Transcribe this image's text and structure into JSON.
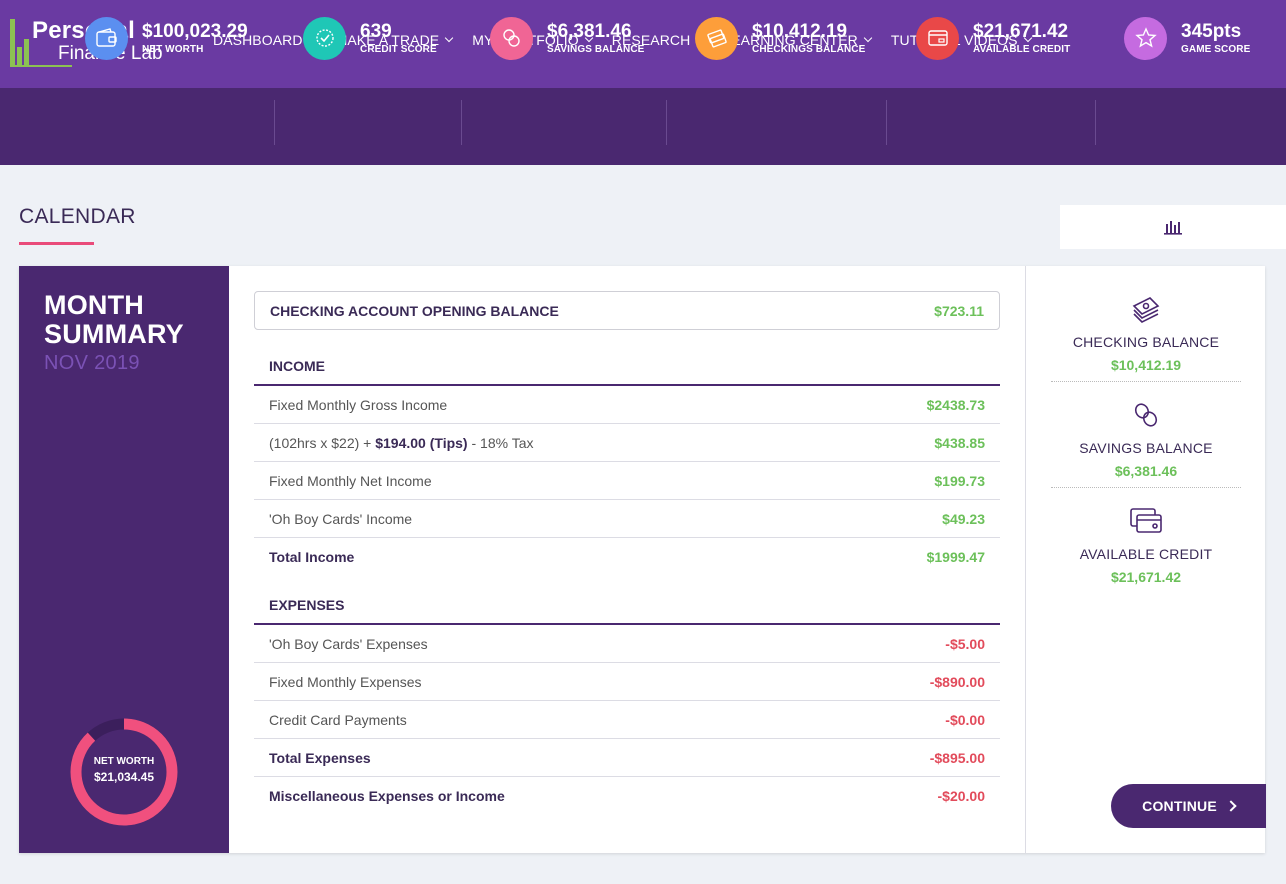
{
  "logo": {
    "line1": "Personal",
    "line2": "Finance Lab"
  },
  "nav": [
    {
      "label": "DASHBOARD"
    },
    {
      "label": "MAKE A TRADE"
    },
    {
      "label": "MY PORTFOLIO"
    },
    {
      "label": "RESEARCH"
    },
    {
      "label": "LEARNING CENTER"
    },
    {
      "label": "TUTORIAL VIDEOS"
    }
  ],
  "stats": [
    {
      "value": "$100,023.29",
      "label": "NET WORTH",
      "icon": "wallet-icon",
      "color": "#5b8ff0"
    },
    {
      "value": "639",
      "label": "CREDIT SCORE",
      "icon": "badge-check-icon",
      "color": "#1fc7b6"
    },
    {
      "value": "$6,381.46",
      "label": "SAVINGS BALANCE",
      "icon": "coins-icon",
      "color": "#f06595"
    },
    {
      "value": "$10,412.19",
      "label": "CHECKINGS BALANCE",
      "icon": "cash-stack-icon",
      "color": "#fd9e3a"
    },
    {
      "value": "$21,671.42",
      "label": "AVAILABLE CREDIT",
      "icon": "credit-card-icon",
      "color": "#e94848"
    },
    {
      "value": "345pts",
      "label": "GAME SCORE",
      "icon": "star-icon",
      "color": "#c56be0"
    }
  ],
  "calendar": {
    "title": "CALENDAR"
  },
  "summary": {
    "title_line1": "MONTH",
    "title_line2": "SUMMARY",
    "month": "NOV 2019",
    "donut": {
      "label": "NET WORTH",
      "value": "$21,034.45",
      "fill_fraction": 0.88,
      "color": "#f0507e",
      "track": "#3b1f5c"
    }
  },
  "opening": {
    "label": "CHECKING ACCOUNT OPENING BALANCE",
    "amount": "$723.11"
  },
  "income": {
    "heading": "INCOME",
    "rows": [
      {
        "label": "Fixed Monthly Gross Income",
        "amount": "$2438.73"
      },
      {
        "label_pre": "(102hrs x $22) + ",
        "label_bold": "$194.00 (Tips)",
        "label_post": " - 18% Tax",
        "amount": "$438.85"
      },
      {
        "label": "Fixed Monthly Net Income",
        "amount": "$199.73"
      },
      {
        "label": "'Oh Boy Cards' Income",
        "amount": "$49.23"
      }
    ],
    "total": {
      "label": "Total Income",
      "amount": "$1999.47"
    }
  },
  "expenses": {
    "heading": "EXPENSES",
    "rows": [
      {
        "label": "'Oh Boy Cards' Expenses",
        "amount": "-$5.00"
      },
      {
        "label": "Fixed Monthly Expenses",
        "amount": "-$890.00"
      },
      {
        "label": "Credit Card Payments",
        "amount": "-$0.00"
      }
    ],
    "total": {
      "label": "Total Expenses",
      "amount": "-$895.00"
    },
    "misc": {
      "label": "Miscellaneous Expenses or Income",
      "amount": "-$20.00"
    }
  },
  "accounts": [
    {
      "name": "CHECKING BALANCE",
      "amount": "$10,412.19",
      "icon": "cash-stack-icon"
    },
    {
      "name": "SAVINGS BALANCE",
      "amount": "$6,381.46",
      "icon": "coins-icon"
    },
    {
      "name": "AVAILABLE CREDIT",
      "amount": "$21,671.42",
      "icon": "credit-card-icon"
    }
  ],
  "continue_label": "CONTINUE"
}
